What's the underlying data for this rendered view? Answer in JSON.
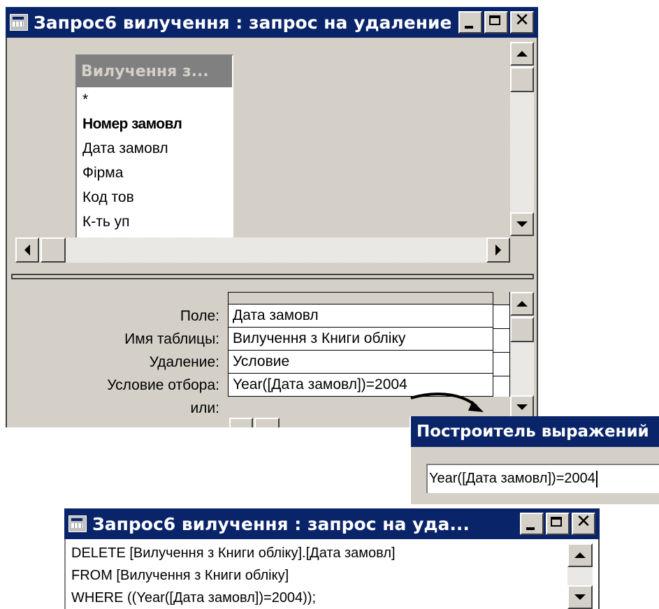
{
  "query_window": {
    "title": "Запрос6 вилучення : запрос на удаление",
    "field_list": {
      "title": "Вилучення з...",
      "fields": [
        {
          "label": "*",
          "bold": false
        },
        {
          "label": "Номер замовл",
          "bold": true
        },
        {
          "label": "Дата замовл",
          "bold": false
        },
        {
          "label": "Фірма",
          "bold": false
        },
        {
          "label": "Код тов",
          "bold": false
        },
        {
          "label": "К-ть уп",
          "bold": false
        }
      ]
    },
    "grid": {
      "row_labels": {
        "field": "Поле:",
        "table": "Имя таблицы:",
        "delete": "Удаление:",
        "criteria": "Условие отбора:",
        "or": "или:"
      },
      "values": {
        "field": "Дата замовл",
        "table": "Вилучення з Книги обліку",
        "delete": "Условие",
        "criteria": "Year([Дата замовл])=2004",
        "or": ""
      }
    }
  },
  "expression_builder": {
    "title": "Построитель выражений",
    "expression": "Year([Дата замовл])=2004"
  },
  "sql_window": {
    "title": "Запрос6 вилучення : запрос на уда...",
    "sql_lines": [
      "DELETE [Вилучення з Книги обліку].[Дата замовл]",
      "FROM [Вилучення з Книги обліку]",
      "WHERE ((Year([Дата замовл])=2004));"
    ]
  },
  "icons": {
    "window_icon": "query-icon",
    "minimize": "minimize-icon",
    "maximize": "maximize-icon",
    "close": "close-icon",
    "close_glyph": "✕"
  },
  "colors": {
    "titlebar": "#0a246a",
    "face": "#d4d0c8",
    "field_list_header": "#808080"
  }
}
